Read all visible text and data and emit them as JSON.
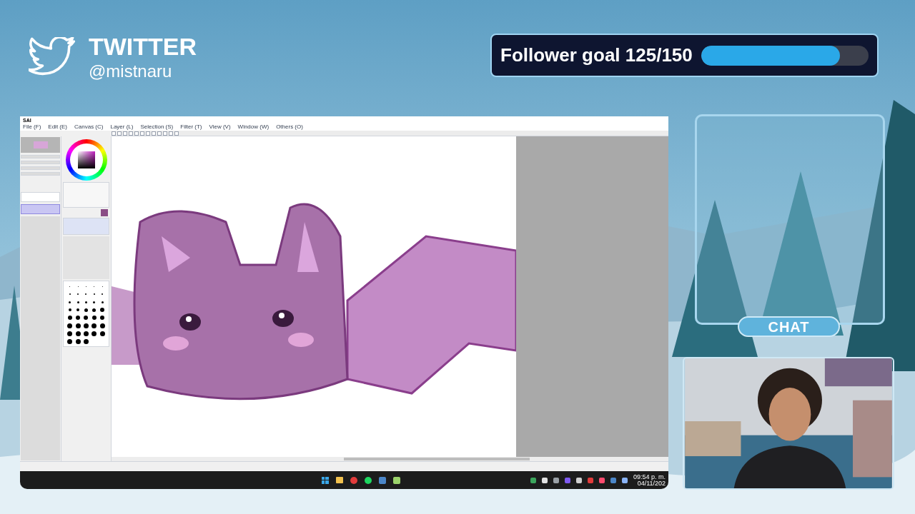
{
  "twitter": {
    "title": "TWITTER",
    "handle": "@mistnaru"
  },
  "follower_goal": {
    "label": "Follower goal 125/150",
    "level": 0.83
  },
  "app": {
    "title": "SAI",
    "menu": [
      "File (F)",
      "Edit (E)",
      "Canvas (C)",
      "Layer (L)",
      "Selection (S)",
      "Filter (T)",
      "View (V)",
      "Window (W)",
      "Others (O)"
    ]
  },
  "chat": {
    "label": "CHAT"
  },
  "taskbar": {
    "time": "09:54 p. m.",
    "date": "04/11/202"
  }
}
